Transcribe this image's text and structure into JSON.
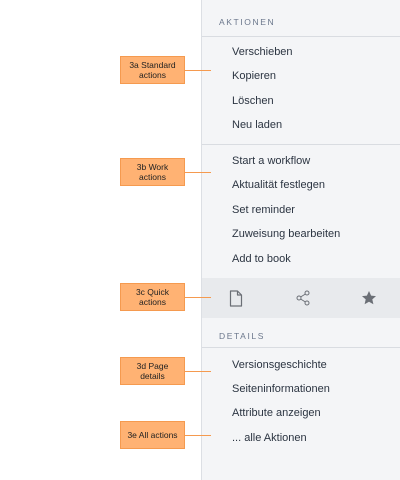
{
  "sections": {
    "actions_header": "AKTIONEN",
    "details_header": "DETAILS"
  },
  "standard_actions": [
    "Verschieben",
    "Kopieren",
    "Löschen",
    "Neu laden"
  ],
  "work_actions": [
    "Start a workflow",
    "Aktualität festlegen",
    "Set reminder",
    "Zuweisung bearbeiten",
    "Add to book"
  ],
  "quick_actions": [
    {
      "icon": "document-icon"
    },
    {
      "icon": "share-icon"
    },
    {
      "icon": "star-icon"
    }
  ],
  "detail_actions": [
    "Versionsgeschichte",
    "Seiteninformationen",
    "Attribute anzeigen",
    "... alle Aktionen"
  ],
  "callouts": {
    "standard": "3a Standard\nactions",
    "work": "3b Work\nactions",
    "quick": "3c Quick\nactions",
    "page_details": "3d  Page\ndetails",
    "all_actions": "3e All actions"
  },
  "colors": {
    "callout_fill": "#ffb273",
    "callout_border": "#f59a4f",
    "panel_bg": "#f4f5f7",
    "quick_bar_bg": "#e8eaed",
    "icon": "#6b6f76",
    "text": "#2b3441",
    "section_header": "#6b778c"
  }
}
